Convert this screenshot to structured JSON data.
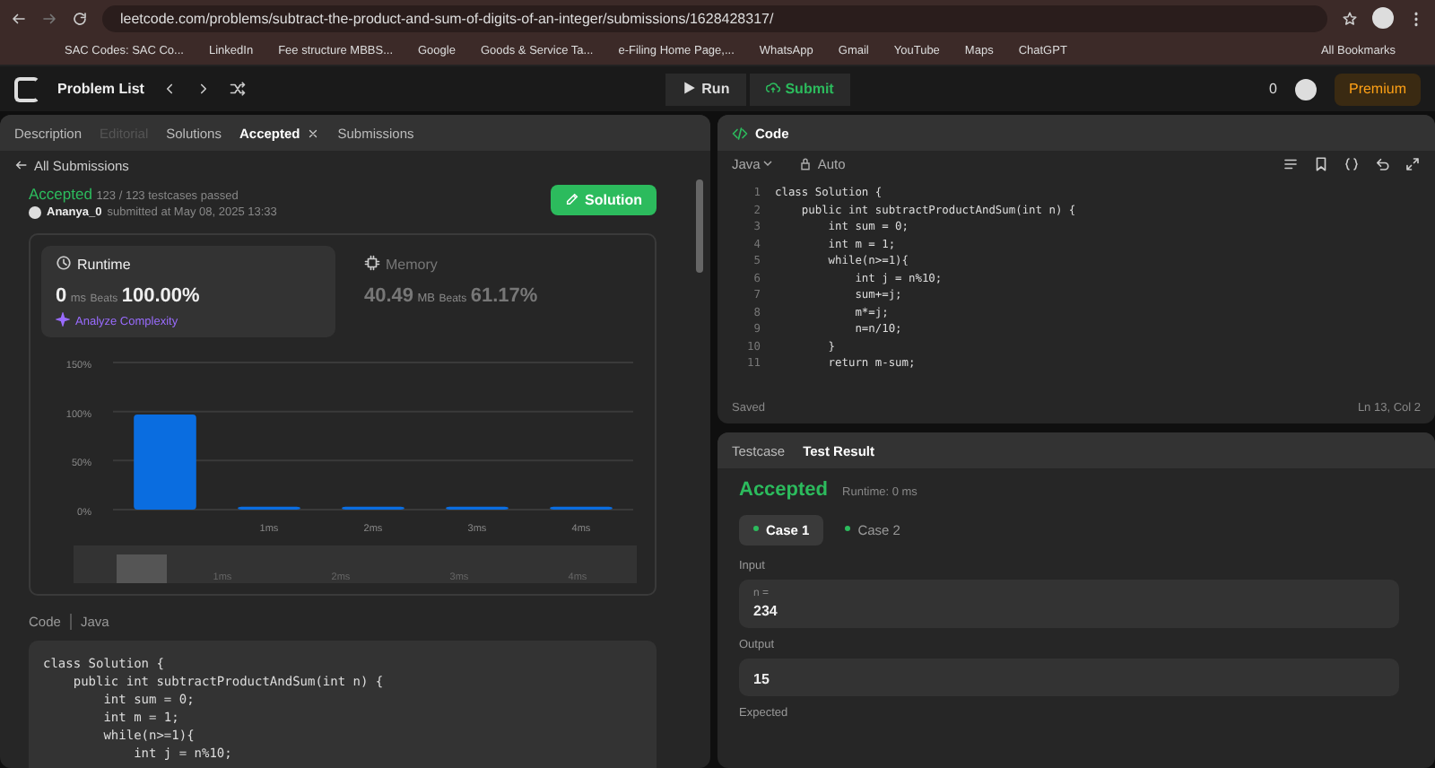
{
  "browser": {
    "url": "leetcode.com/problems/subtract-the-product-and-sum-of-digits-of-an-integer/submissions/1628428317/",
    "bookmarks": [
      {
        "label": "SAC Codes: SAC Co..."
      },
      {
        "label": "LinkedIn"
      },
      {
        "label": "Fee structure MBBS..."
      },
      {
        "label": "Google"
      },
      {
        "label": "Goods & Service Ta..."
      },
      {
        "label": "e-Filing Home Page,..."
      },
      {
        "label": "WhatsApp"
      },
      {
        "label": "Gmail"
      },
      {
        "label": "YouTube"
      },
      {
        "label": "Maps"
      },
      {
        "label": "ChatGPT"
      }
    ],
    "all_bookmarks": "All Bookmarks"
  },
  "nav": {
    "problem_list": "Problem List",
    "run": "Run",
    "submit": "Submit",
    "streak": "0",
    "premium": "Premium"
  },
  "left_tabs": [
    {
      "label": "Description",
      "selected": false,
      "disabled": false,
      "closable": false
    },
    {
      "label": "Editorial",
      "selected": false,
      "disabled": true,
      "closable": false
    },
    {
      "label": "Solutions",
      "selected": false,
      "disabled": false,
      "closable": false
    },
    {
      "label": "Accepted",
      "selected": true,
      "disabled": false,
      "closable": true
    },
    {
      "label": "Submissions",
      "selected": false,
      "disabled": false,
      "closable": false
    }
  ],
  "back_link": "All Submissions",
  "submission": {
    "status": "Accepted",
    "passed": "123 / 123 testcases passed",
    "user": "Ananya_0",
    "submitted": "submitted at May 08, 2025 13:33",
    "solution_button": "Solution"
  },
  "runtime": {
    "title": "Runtime",
    "value": "0",
    "unit": "ms",
    "beats_label": "Beats",
    "beats": "100.00%",
    "analyze": "Analyze Complexity",
    "selected": true
  },
  "memory": {
    "title": "Memory",
    "value": "40.49",
    "unit": "MB",
    "beats_label": "Beats",
    "beats": "61.17%",
    "selected": false
  },
  "chart": {
    "chart_data": {
      "type": "bar",
      "categories": [
        null,
        "1ms",
        "2ms",
        "3ms",
        "4ms"
      ],
      "values": [
        97,
        3,
        3,
        3,
        3
      ],
      "ylim": [
        0,
        150
      ],
      "yticks": [
        {
          "value": 0,
          "label": "0%"
        },
        {
          "value": 50,
          "label": "50%"
        },
        {
          "value": 100,
          "label": "100%"
        },
        {
          "value": 150,
          "label": "150%"
        }
      ]
    },
    "brush_labels": [
      "1ms",
      "2ms",
      "3ms",
      "4ms"
    ]
  },
  "code_header": {
    "title": "Code",
    "language": "Java"
  },
  "left_code": [
    "class Solution {",
    "    public int subtractProductAndSum(int n) {",
    "        int sum = 0;",
    "        int m = 1;",
    "        while(n>=1){",
    "            int j = n%10;"
  ],
  "editor": {
    "title": "Code",
    "language": "Java",
    "mode": "Auto",
    "lines": [
      {
        "num": "1",
        "text": "class Solution {"
      },
      {
        "num": "2",
        "text": "    public int subtractProductAndSum(int n) {"
      },
      {
        "num": "3",
        "text": "        int sum = 0;"
      },
      {
        "num": "4",
        "text": "        int m = 1;"
      },
      {
        "num": "5",
        "text": "        while(n>=1){"
      },
      {
        "num": "6",
        "text": "            int j = n%10;"
      },
      {
        "num": "7",
        "text": "            sum+=j;"
      },
      {
        "num": "8",
        "text": "            m*=j;"
      },
      {
        "num": "9",
        "text": "            n=n/10;"
      },
      {
        "num": "10",
        "text": "        }"
      },
      {
        "num": "11",
        "text": "        return m-sum;"
      }
    ],
    "saved": "Saved",
    "cursor": "Ln 13, Col 2"
  },
  "result_tabs": [
    {
      "label": "Testcase",
      "selected": false
    },
    {
      "label": "Test Result",
      "selected": true
    }
  ],
  "result": {
    "status": "Accepted",
    "runtime": "Runtime: 0 ms",
    "cases": [
      {
        "label": "Case 1",
        "selected": true
      },
      {
        "label": "Case 2",
        "selected": false
      }
    ],
    "input_label": "Input",
    "input_name": "n =",
    "input_value": "234",
    "output_label": "Output",
    "output_value": "15",
    "expected_label": "Expected"
  }
}
